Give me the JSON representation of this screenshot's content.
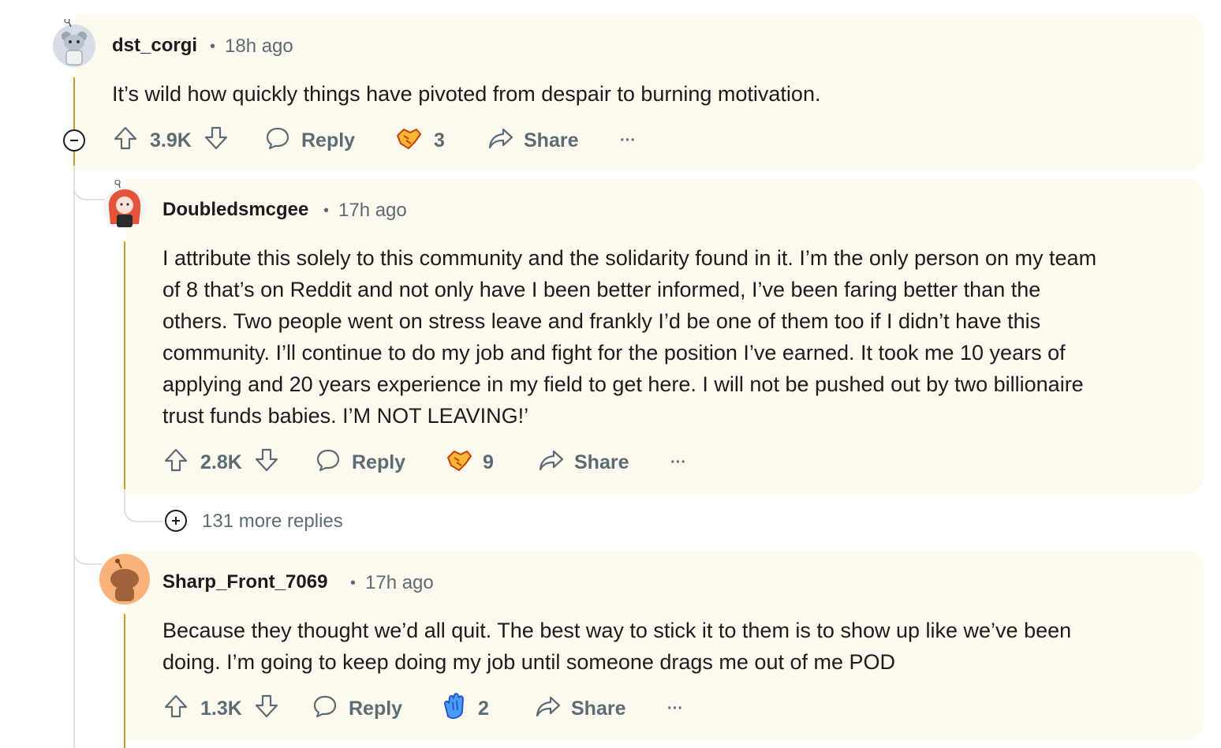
{
  "comments": [
    {
      "username": "dst_corgi",
      "time": "18h ago",
      "body": "It’s wild how quickly things have pivoted from despair to burning motivation.",
      "score": "3.9K",
      "reply_label": "Reply",
      "award_count": "3",
      "share_label": "Share",
      "more_label": "···"
    },
    {
      "username": "Doubledsmcgee",
      "time": "17h ago",
      "body_lines": [
        "I attribute this solely to this community and the solidarity found in it. I’m the only person on my team",
        "of 8 that’s on Reddit and not only have I been better informed, I’ve been faring better than the",
        "others. Two people went on stress leave and frankly I’d be one of them too if I didn’t have this",
        "community. I’ll continue to do my job and fight for the position I’ve earned. It took me 10 years of",
        "applying and 20 years experience in my field to get here. I will not be pushed out by two billionaire",
        "trust funds babies. I’M NOT LEAVING!’"
      ],
      "score": "2.8K",
      "reply_label": "Reply",
      "award_count": "9",
      "share_label": "Share",
      "more_label": "···"
    },
    {
      "username": "Sharp_Front_7069",
      "time": "17h ago",
      "body_lines": [
        "Because they thought we’d all quit. The best way to stick it to them is to show up like we’ve been",
        "doing. I’m going to keep doing my job until someone drags me out of me POD"
      ],
      "score": "1.3K",
      "reply_label": "Reply",
      "award_count": "2",
      "share_label": "Share",
      "more_label": "···"
    }
  ],
  "more_replies": "131 more replies",
  "separator": "•",
  "colors": {
    "card_bg": "#fdf9ee",
    "thread_accent": "#c9a227",
    "meta_grey": "#5c6c74",
    "award_orange": "#f5a623",
    "award_blue": "#4a9cf0"
  },
  "icons": {
    "upvote": "upvote-icon",
    "downvote": "downvote-icon",
    "reply": "reply-bubble-icon",
    "award_1": "handshake-award-icon",
    "award_3": "clapping-hands-award-icon",
    "share": "share-arrow-icon",
    "more": "overflow-dots-icon",
    "collapse": "minus-circle-icon",
    "expand": "plus-circle-icon"
  }
}
